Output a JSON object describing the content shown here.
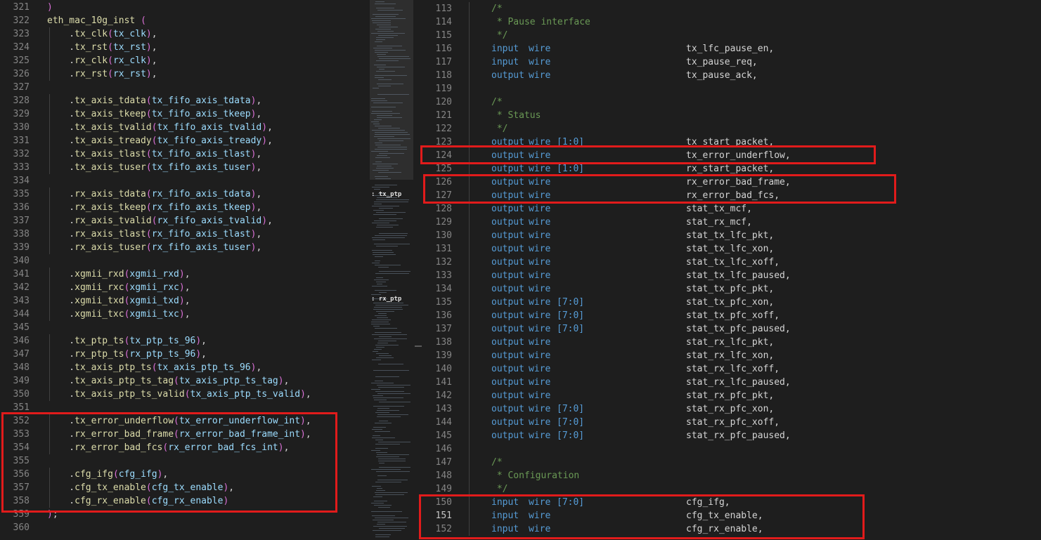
{
  "left_editor": {
    "lines": [
      {
        "n": "321",
        "segs": [
          [
            "t-paren",
            ")"
          ]
        ]
      },
      {
        "n": "322",
        "segs": [
          [
            "t-fn",
            "eth_mac_10g_inst"
          ],
          [
            "t-punc",
            " "
          ],
          [
            "t-paren",
            "("
          ]
        ]
      },
      {
        "n": "323",
        "indent": 1,
        "port": "tx_clk",
        "sig": "tx_clk",
        "end": ","
      },
      {
        "n": "324",
        "indent": 1,
        "port": "tx_rst",
        "sig": "tx_rst",
        "end": ","
      },
      {
        "n": "325",
        "indent": 1,
        "port": "rx_clk",
        "sig": "rx_clk",
        "end": ","
      },
      {
        "n": "326",
        "indent": 1,
        "port": "rx_rst",
        "sig": "rx_rst",
        "end": ","
      },
      {
        "n": "327",
        "blank": true
      },
      {
        "n": "328",
        "indent": 1,
        "port": "tx_axis_tdata",
        "sig": "tx_fifo_axis_tdata",
        "end": ","
      },
      {
        "n": "329",
        "indent": 1,
        "port": "tx_axis_tkeep",
        "sig": "tx_fifo_axis_tkeep",
        "end": ","
      },
      {
        "n": "330",
        "indent": 1,
        "port": "tx_axis_tvalid",
        "sig": "tx_fifo_axis_tvalid",
        "end": ","
      },
      {
        "n": "331",
        "indent": 1,
        "port": "tx_axis_tready",
        "sig": "tx_fifo_axis_tready",
        "end": ","
      },
      {
        "n": "332",
        "indent": 1,
        "port": "tx_axis_tlast",
        "sig": "tx_fifo_axis_tlast",
        "end": ","
      },
      {
        "n": "333",
        "indent": 1,
        "port": "tx_axis_tuser",
        "sig": "tx_fifo_axis_tuser",
        "end": ","
      },
      {
        "n": "334",
        "blank": true
      },
      {
        "n": "335",
        "indent": 1,
        "port": "rx_axis_tdata",
        "sig": "rx_fifo_axis_tdata",
        "end": ","
      },
      {
        "n": "336",
        "indent": 1,
        "port": "rx_axis_tkeep",
        "sig": "rx_fifo_axis_tkeep",
        "end": ","
      },
      {
        "n": "337",
        "indent": 1,
        "port": "rx_axis_tvalid",
        "sig": "rx_fifo_axis_tvalid",
        "end": ","
      },
      {
        "n": "338",
        "indent": 1,
        "port": "rx_axis_tlast",
        "sig": "rx_fifo_axis_tlast",
        "end": ","
      },
      {
        "n": "339",
        "indent": 1,
        "port": "rx_axis_tuser",
        "sig": "rx_fifo_axis_tuser",
        "end": ","
      },
      {
        "n": "340",
        "blank": true
      },
      {
        "n": "341",
        "indent": 1,
        "port": "xgmii_rxd",
        "sig": "xgmii_rxd",
        "end": ","
      },
      {
        "n": "342",
        "indent": 1,
        "port": "xgmii_rxc",
        "sig": "xgmii_rxc",
        "end": ","
      },
      {
        "n": "343",
        "indent": 1,
        "port": "xgmii_txd",
        "sig": "xgmii_txd",
        "end": ","
      },
      {
        "n": "344",
        "indent": 1,
        "port": "xgmii_txc",
        "sig": "xgmii_txc",
        "end": ","
      },
      {
        "n": "345",
        "blank": true
      },
      {
        "n": "346",
        "indent": 1,
        "port": "tx_ptp_ts",
        "sig": "tx_ptp_ts_96",
        "end": ","
      },
      {
        "n": "347",
        "indent": 1,
        "port": "rx_ptp_ts",
        "sig": "rx_ptp_ts_96",
        "end": ","
      },
      {
        "n": "348",
        "indent": 1,
        "port": "tx_axis_ptp_ts",
        "sig": "tx_axis_ptp_ts_96",
        "end": ","
      },
      {
        "n": "349",
        "indent": 1,
        "port": "tx_axis_ptp_ts_tag",
        "sig": "tx_axis_ptp_ts_tag",
        "end": ","
      },
      {
        "n": "350",
        "indent": 1,
        "port": "tx_axis_ptp_ts_valid",
        "sig": "tx_axis_ptp_ts_valid",
        "end": ","
      },
      {
        "n": "351",
        "blank": true
      },
      {
        "n": "352",
        "indent": 1,
        "port": "tx_error_underflow",
        "sig": "tx_error_underflow_int",
        "end": ","
      },
      {
        "n": "353",
        "indent": 1,
        "port": "rx_error_bad_frame",
        "sig": "rx_error_bad_frame_int",
        "end": ","
      },
      {
        "n": "354",
        "indent": 1,
        "port": "rx_error_bad_fcs",
        "sig": "rx_error_bad_fcs_int",
        "end": ","
      },
      {
        "n": "355",
        "blank": true
      },
      {
        "n": "356",
        "indent": 1,
        "port": "cfg_ifg",
        "sig": "cfg_ifg",
        "end": ","
      },
      {
        "n": "357",
        "indent": 1,
        "port": "cfg_tx_enable",
        "sig": "cfg_tx_enable",
        "end": ","
      },
      {
        "n": "358",
        "indent": 1,
        "port": "cfg_rx_enable",
        "sig": "cfg_rx_enable",
        "end": ""
      },
      {
        "n": "359",
        "segs": [
          [
            "t-paren",
            ")"
          ],
          [
            "t-punc",
            ";"
          ]
        ]
      },
      {
        "n": "360",
        "blank": true
      }
    ]
  },
  "minimap": {
    "labels": [
      ": tx_ptp",
      ": rx_ptp"
    ]
  },
  "right_editor": {
    "lines": [
      {
        "n": "113",
        "comment": "/*"
      },
      {
        "n": "114",
        "comment": " * Pause interface"
      },
      {
        "n": "115",
        "comment": " */"
      },
      {
        "n": "116",
        "dir": "input",
        "type": "wire",
        "range": "",
        "name": "tx_lfc_pause_en,"
      },
      {
        "n": "117",
        "dir": "input",
        "type": "wire",
        "range": "",
        "name": "tx_pause_req,"
      },
      {
        "n": "118",
        "dir": "output",
        "type": "wire",
        "range": "",
        "name": "tx_pause_ack,"
      },
      {
        "n": "119",
        "blank": true
      },
      {
        "n": "120",
        "comment": "/*"
      },
      {
        "n": "121",
        "comment": " * Status"
      },
      {
        "n": "122",
        "comment": " */"
      },
      {
        "n": "123",
        "dir": "output",
        "type": "wire",
        "range": "[1:0]",
        "name": "tx_start_packet,"
      },
      {
        "n": "124",
        "dir": "output",
        "type": "wire",
        "range": "",
        "name": "tx_error_underflow,"
      },
      {
        "n": "125",
        "dir": "output",
        "type": "wire",
        "range": "[1:0]",
        "name": "rx_start_packet,"
      },
      {
        "n": "126",
        "dir": "output",
        "type": "wire",
        "range": "",
        "name": "rx_error_bad_frame,"
      },
      {
        "n": "127",
        "dir": "output",
        "type": "wire",
        "range": "",
        "name": "rx_error_bad_fcs,"
      },
      {
        "n": "128",
        "dir": "output",
        "type": "wire",
        "range": "",
        "name": "stat_tx_mcf,"
      },
      {
        "n": "129",
        "dir": "output",
        "type": "wire",
        "range": "",
        "name": "stat_rx_mcf,"
      },
      {
        "n": "130",
        "dir": "output",
        "type": "wire",
        "range": "",
        "name": "stat_tx_lfc_pkt,"
      },
      {
        "n": "131",
        "dir": "output",
        "type": "wire",
        "range": "",
        "name": "stat_tx_lfc_xon,"
      },
      {
        "n": "132",
        "dir": "output",
        "type": "wire",
        "range": "",
        "name": "stat_tx_lfc_xoff,"
      },
      {
        "n": "133",
        "dir": "output",
        "type": "wire",
        "range": "",
        "name": "stat_tx_lfc_paused,"
      },
      {
        "n": "134",
        "dir": "output",
        "type": "wire",
        "range": "",
        "name": "stat_tx_pfc_pkt,"
      },
      {
        "n": "135",
        "dir": "output",
        "type": "wire",
        "range": "[7:0]",
        "name": "stat_tx_pfc_xon,"
      },
      {
        "n": "136",
        "dir": "output",
        "type": "wire",
        "range": "[7:0]",
        "name": "stat_tx_pfc_xoff,"
      },
      {
        "n": "137",
        "dir": "output",
        "type": "wire",
        "range": "[7:0]",
        "name": "stat_tx_pfc_paused,"
      },
      {
        "n": "138",
        "dir": "output",
        "type": "wire",
        "range": "",
        "name": "stat_rx_lfc_pkt,"
      },
      {
        "n": "139",
        "dir": "output",
        "type": "wire",
        "range": "",
        "name": "stat_rx_lfc_xon,"
      },
      {
        "n": "140",
        "dir": "output",
        "type": "wire",
        "range": "",
        "name": "stat_rx_lfc_xoff,"
      },
      {
        "n": "141",
        "dir": "output",
        "type": "wire",
        "range": "",
        "name": "stat_rx_lfc_paused,"
      },
      {
        "n": "142",
        "dir": "output",
        "type": "wire",
        "range": "",
        "name": "stat_rx_pfc_pkt,"
      },
      {
        "n": "143",
        "dir": "output",
        "type": "wire",
        "range": "[7:0]",
        "name": "stat_rx_pfc_xon,"
      },
      {
        "n": "144",
        "dir": "output",
        "type": "wire",
        "range": "[7:0]",
        "name": "stat_rx_pfc_xoff,"
      },
      {
        "n": "145",
        "dir": "output",
        "type": "wire",
        "range": "[7:0]",
        "name": "stat_rx_pfc_paused,"
      },
      {
        "n": "146",
        "blank": true
      },
      {
        "n": "147",
        "comment": "/*"
      },
      {
        "n": "148",
        "comment": " * Configuration"
      },
      {
        "n": "149",
        "comment": " */"
      },
      {
        "n": "150",
        "dir": "input",
        "type": "wire",
        "range": "[7:0]",
        "name": "cfg_ifg,"
      },
      {
        "n": "151",
        "dir": "input",
        "type": "wire",
        "range": "",
        "name": "cfg_tx_enable,",
        "active": true
      },
      {
        "n": "152",
        "dir": "input",
        "type": "wire",
        "range": "",
        "name": "cfg_rx_enable,"
      }
    ]
  },
  "highlight_color": "#e11b1b",
  "colors": {
    "background": "#1e1e1e",
    "keyword": "#569cd6",
    "function": "#dcdcaa",
    "variable": "#9cdcfe",
    "comment": "#6a9955",
    "bracket": "#da70d6",
    "line_number": "#858585"
  }
}
